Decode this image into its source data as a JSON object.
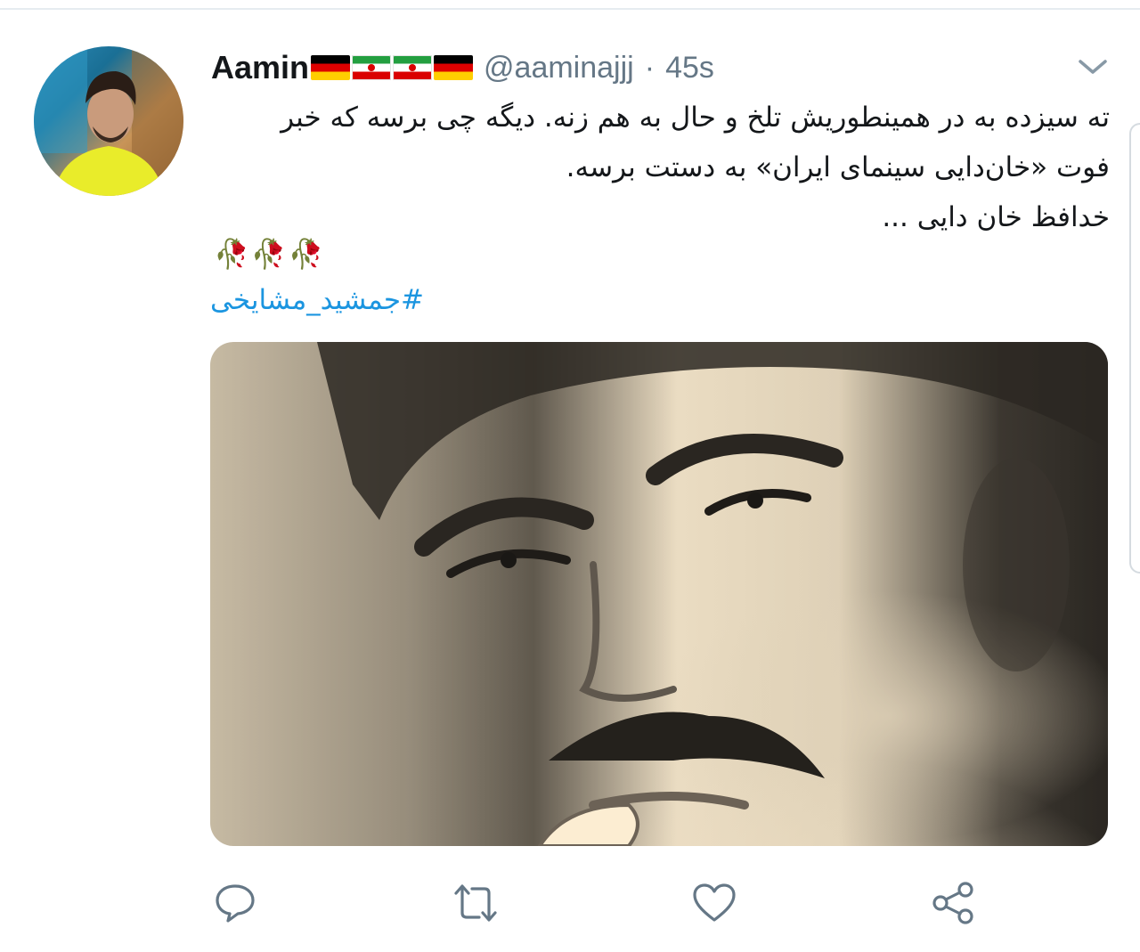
{
  "tweet": {
    "display_name": "Aamin",
    "handle": "@aaminajjj",
    "separator": "·",
    "timestamp": "45s",
    "text_lines": [
      "ته سیزده به در همینطوریش تلخ و حال به هم زنه. دیگه چی برسه که خبر",
      "فوت «خان‌دایی سینمای ایران» به دستت برسه.",
      "خدافظ خان دایی ..."
    ],
    "roses": "🥀🥀🥀",
    "hashtag": "#جمشید_مشایخی"
  },
  "icons": {
    "flags": [
      "flag-germany",
      "flag-iran",
      "flag-iran",
      "flag-germany"
    ],
    "menu": "chevron-down-icon",
    "actions": [
      "reply-icon",
      "retweet-icon",
      "like-icon",
      "share-icon"
    ]
  },
  "colors": {
    "text_primary": "#14171a",
    "text_secondary": "#657786",
    "hashtag": "#1b95e0",
    "divider": "#e6ecf0"
  }
}
